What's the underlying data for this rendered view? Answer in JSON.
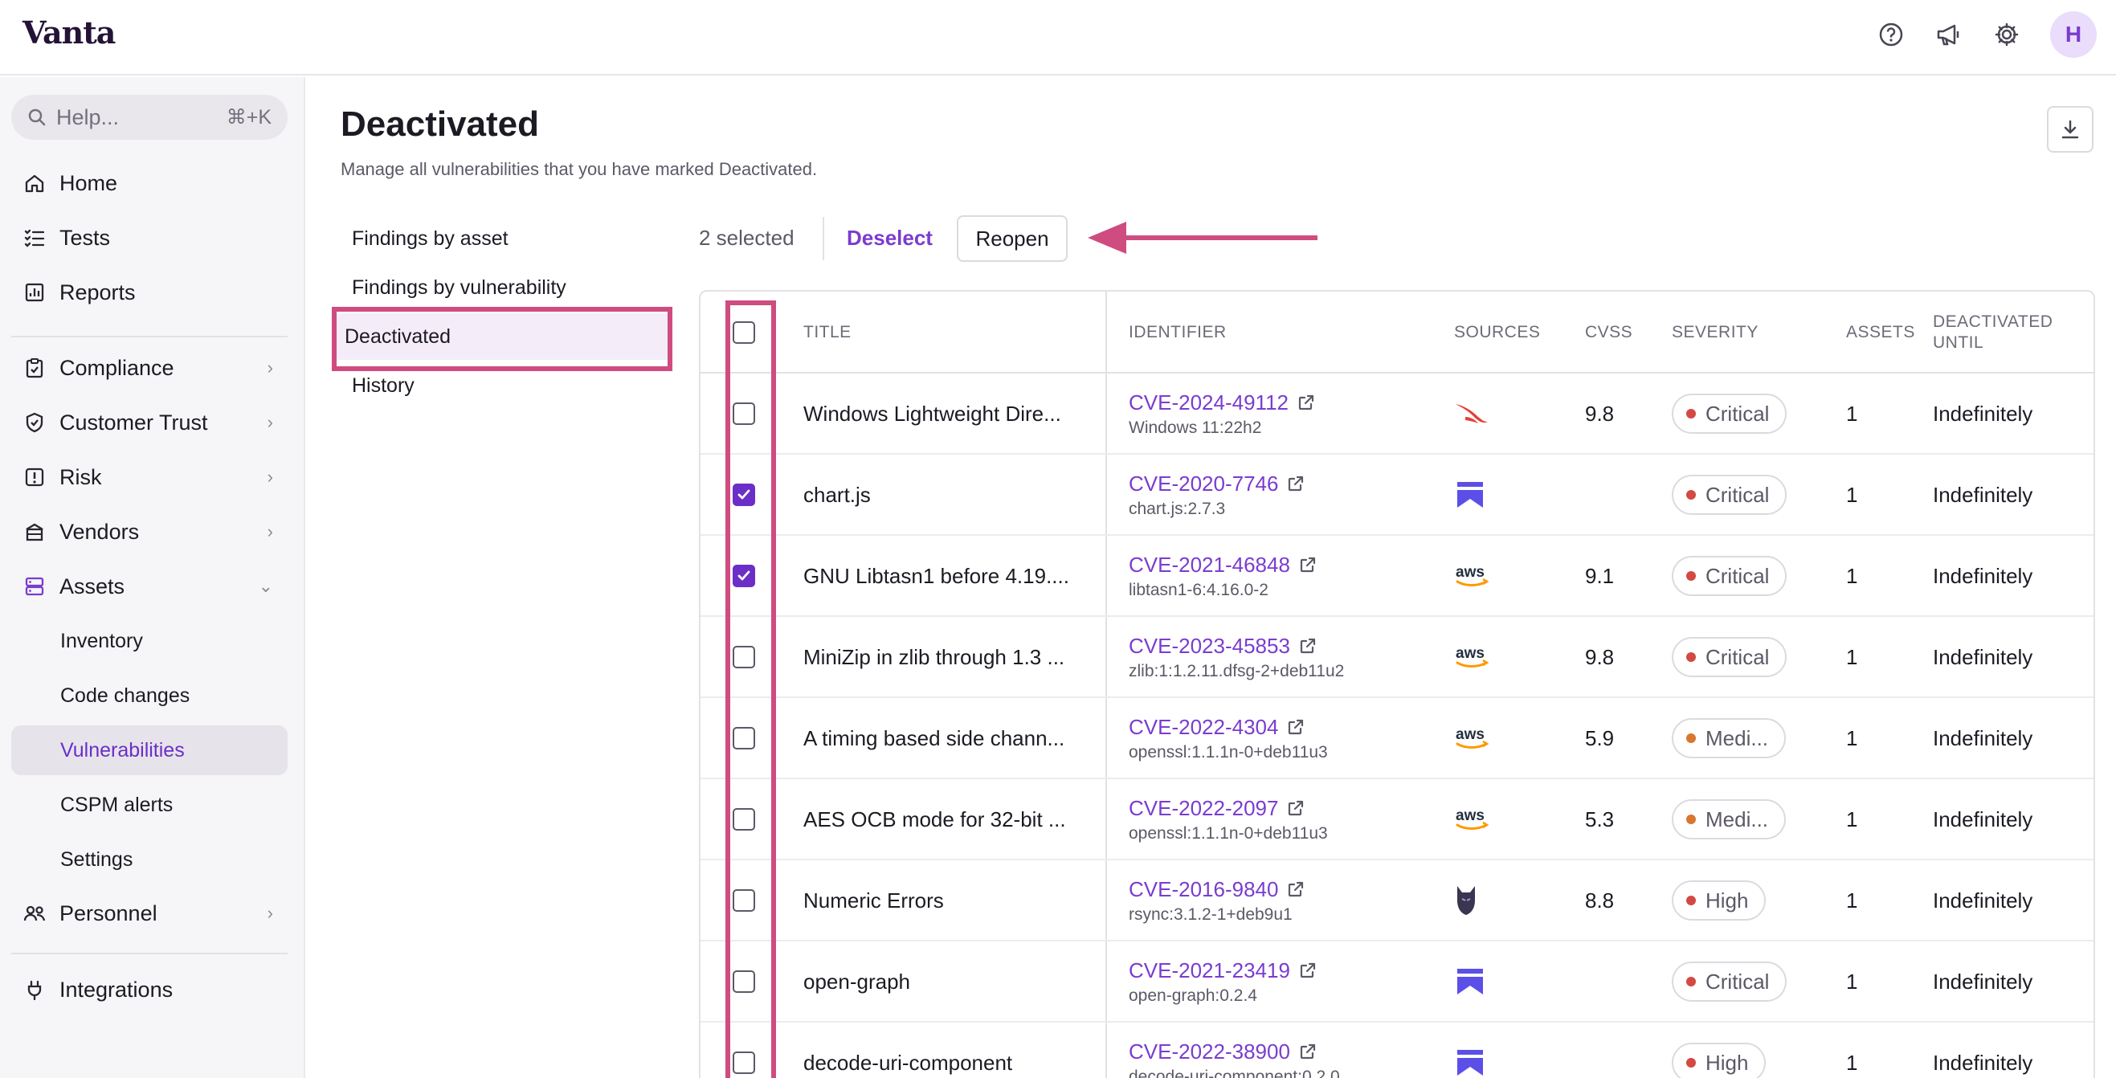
{
  "app": {
    "logo": "Vanta",
    "avatar_initial": "H"
  },
  "sidebar": {
    "search_placeholder": "Help...",
    "search_shortcut": "⌘+K",
    "items": [
      {
        "label": "Home",
        "icon": "home-icon"
      },
      {
        "label": "Tests",
        "icon": "checklist-icon"
      },
      {
        "label": "Reports",
        "icon": "chart-icon"
      },
      {
        "label": "Compliance",
        "icon": "clipboard-icon"
      },
      {
        "label": "Customer Trust",
        "icon": "shield-icon"
      },
      {
        "label": "Risk",
        "icon": "alert-icon"
      },
      {
        "label": "Vendors",
        "icon": "building-icon"
      },
      {
        "label": "Assets",
        "icon": "server-icon"
      },
      {
        "label": "Personnel",
        "icon": "people-icon"
      },
      {
        "label": "Integrations",
        "icon": "plug-icon"
      }
    ],
    "asset_subitems": [
      "Inventory",
      "Code changes",
      "Vulnerabilities",
      "CSPM alerts",
      "Settings"
    ]
  },
  "page": {
    "title": "Deactivated",
    "subtitle": "Manage all vulnerabilities that you have marked Deactivated."
  },
  "subnav": [
    "Findings by asset",
    "Findings by vulnerability",
    "Deactivated",
    "History"
  ],
  "toolbar": {
    "selected_text": "2 selected",
    "deselect_label": "Deselect",
    "reopen_label": "Reopen"
  },
  "table": {
    "headers": [
      "TITLE",
      "IDENTIFIER",
      "SOURCES",
      "CVSS",
      "SEVERITY",
      "ASSETS",
      "DEACTIVATED",
      "UNTIL"
    ],
    "rows": [
      {
        "title": "Windows Lightweight Dire...",
        "id": "CVE-2024-49112",
        "sub": "Windows 11:22h2",
        "source": "crowdstrike-icon",
        "cvss": "9.8",
        "severity": "Critical",
        "assets": "1",
        "until": "Indefinitely",
        "checked": false
      },
      {
        "title": "chart.js",
        "id": "CVE-2020-7746",
        "sub": "chart.js:2.7.3",
        "source": "vanta-icon",
        "cvss": "",
        "severity": "Critical",
        "assets": "1",
        "until": "Indefinitely",
        "checked": true
      },
      {
        "title": "GNU Libtasn1 before 4.19....",
        "id": "CVE-2021-46848",
        "sub": "libtasn1-6:4.16.0-2",
        "source": "aws-icon",
        "cvss": "9.1",
        "severity": "Critical",
        "assets": "1",
        "until": "Indefinitely",
        "checked": true
      },
      {
        "title": "MiniZip in zlib through 1.3 ...",
        "id": "CVE-2023-45853",
        "sub": "zlib:1:1.2.11.dfsg-2+deb11u2",
        "source": "aws-icon",
        "cvss": "9.8",
        "severity": "Critical",
        "assets": "1",
        "until": "Indefinitely",
        "checked": false
      },
      {
        "title": "A timing based side chann...",
        "id": "CVE-2022-4304",
        "sub": "openssl:1.1.1n-0+deb11u3",
        "source": "aws-icon",
        "cvss": "5.9",
        "severity": "Medi...",
        "assets": "1",
        "until": "Indefinitely",
        "checked": false
      },
      {
        "title": "AES OCB mode for 32-bit ...",
        "id": "CVE-2022-2097",
        "sub": "openssl:1.1.1n-0+deb11u3",
        "source": "aws-icon",
        "cvss": "5.3",
        "severity": "Medi...",
        "assets": "1",
        "until": "Indefinitely",
        "checked": false
      },
      {
        "title": "Numeric Errors",
        "id": "CVE-2016-9840",
        "sub": "rsync:3.1.2-1+deb9u1",
        "source": "wolf-icon",
        "cvss": "8.8",
        "severity": "High",
        "assets": "1",
        "until": "Indefinitely",
        "checked": false
      },
      {
        "title": "open-graph",
        "id": "CVE-2021-23419",
        "sub": "open-graph:0.2.4",
        "source": "vanta-icon",
        "cvss": "",
        "severity": "Critical",
        "assets": "1",
        "until": "Indefinitely",
        "checked": false
      },
      {
        "title": "decode-uri-component",
        "id": "CVE-2022-38900",
        "sub": "decode-uri-component:0.2.0",
        "source": "vanta-icon",
        "cvss": "",
        "severity": "High",
        "assets": "1",
        "until": "Indefinitely",
        "checked": false
      }
    ]
  },
  "colors": {
    "accent": "#7a3ccf",
    "highlight": "#cf4c80",
    "critical": "#d24a43",
    "medium": "#d9762f",
    "high": "#d24a43"
  }
}
